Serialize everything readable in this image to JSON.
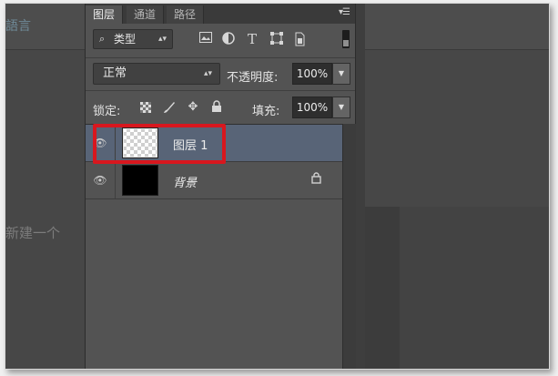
{
  "background": {
    "topbar_text": "語言",
    "text": "新建一个"
  },
  "panel": {
    "tabs": [
      {
        "label": "图层",
        "active": true
      },
      {
        "label": "通道",
        "active": false
      },
      {
        "label": "路径",
        "active": false
      }
    ],
    "filter": {
      "kind_label": "类型",
      "filter_icons": [
        "image-icon",
        "adjustment-icon",
        "text-icon",
        "shape-icon",
        "smart-object-icon"
      ]
    },
    "blend_mode": "正常",
    "opacity_label": "不透明度:",
    "opacity_value": "100%",
    "lock_label": "锁定:",
    "fill_label": "填充:",
    "fill_value": "100%",
    "layers": [
      {
        "name": "图层 1",
        "selected": true,
        "visible": true,
        "thumbnail": "transparent",
        "locked": false
      },
      {
        "name": "背景",
        "selected": false,
        "visible": true,
        "thumbnail": "black",
        "locked": true
      }
    ]
  },
  "colors": {
    "panel_bg": "#535353",
    "selected_row": "#586477",
    "highlight": "#d8171e"
  }
}
